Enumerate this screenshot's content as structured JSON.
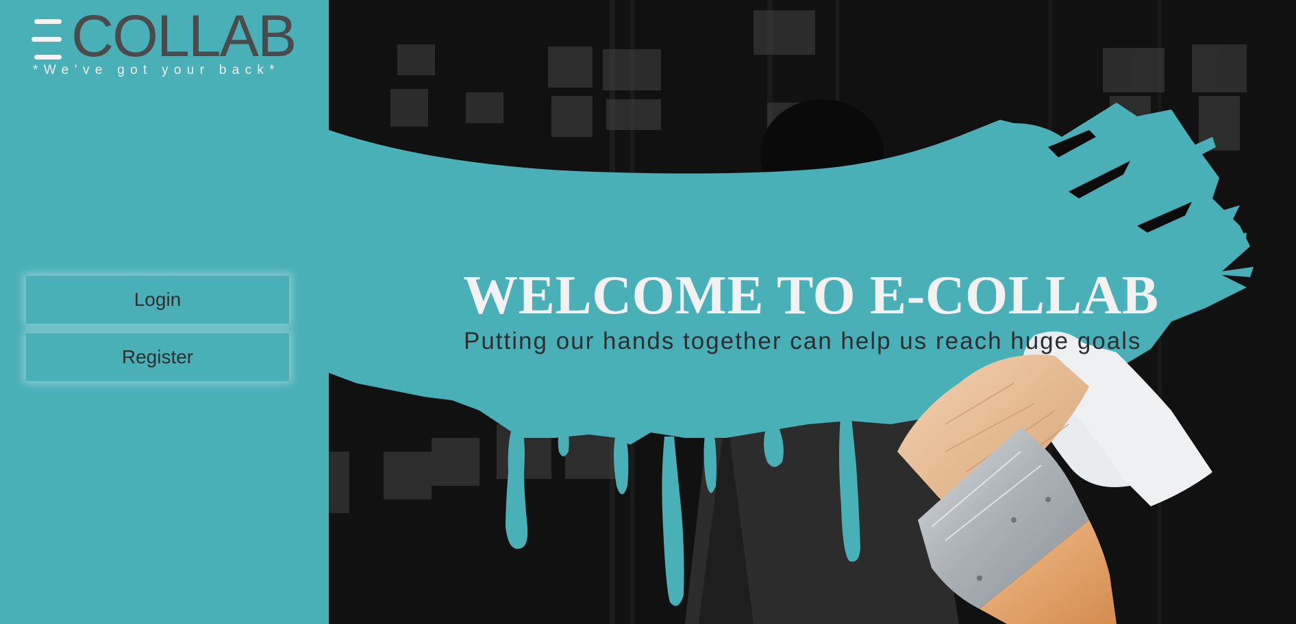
{
  "brand": {
    "name": "COLLAB",
    "tagline": "*We’ve got your back*"
  },
  "nav": {
    "login_label": "Login",
    "register_label": "Register"
  },
  "hero": {
    "title": "WELCOME TO E-COLLAB",
    "subtitle": "Putting our hands together can help us reach huge goals"
  },
  "colors": {
    "accent": "#4ab0b8",
    "text_dark": "#2d2d2d",
    "logo_gray": "#4b4b4b",
    "title_white": "#f2f2f2"
  },
  "icons": {
    "logo_mark": "three-bars-e-logo-icon",
    "brush": "paintbrush-icon"
  }
}
